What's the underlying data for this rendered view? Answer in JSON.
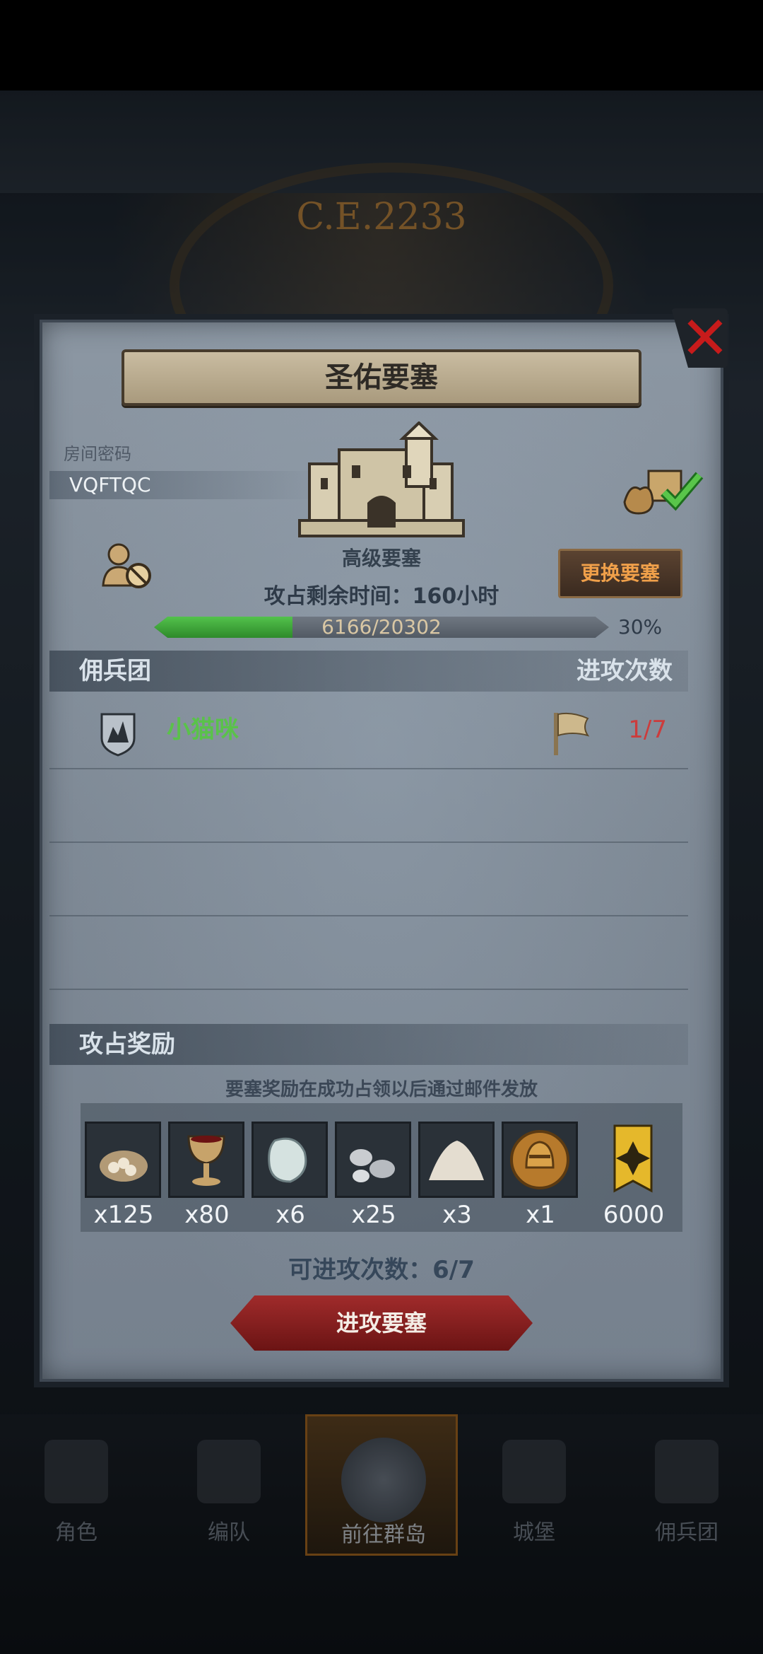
{
  "background": {
    "era_label": "C.E.2233"
  },
  "modal": {
    "title": "圣佑要塞",
    "room_code_label": "房间密码",
    "room_code": "VQFTQC",
    "fortress_grade": "高级要塞",
    "change_fortress_button": "更换要塞",
    "time_remaining": "攻占剩余时间：160小时",
    "progress": {
      "text": "6166/20302",
      "current": 6166,
      "total": 20302,
      "percent_label": "30%"
    },
    "mercenary_section": {
      "left_header": "佣兵团",
      "right_header": "进攻次数"
    },
    "mercenary_rows": [
      {
        "name": "小猫咪",
        "attacks": "1/7"
      }
    ],
    "reward_section": {
      "header": "攻占奖励",
      "note": "要塞奖励在成功占领以后通过邮件发放"
    },
    "rewards": [
      {
        "icon": "supply-sack-icon",
        "qty": "x125"
      },
      {
        "icon": "goblet-icon",
        "qty": "x80"
      },
      {
        "icon": "moonstone-icon",
        "qty": "x6"
      },
      {
        "icon": "silver-ore-icon",
        "qty": "x25"
      },
      {
        "icon": "salt-pile-icon",
        "qty": "x3"
      },
      {
        "icon": "knight-helmet-medal-icon",
        "qty": "x1"
      },
      {
        "icon": "banner-emblem-icon",
        "qty": "6000"
      }
    ],
    "attacks_available": "可进攻次数：6/7",
    "attack_button": "进攻要塞"
  },
  "bottom_nav": [
    {
      "label": "角色"
    },
    {
      "label": "编队"
    },
    {
      "label": "前往群岛"
    },
    {
      "label": "城堡"
    },
    {
      "label": "佣兵团"
    }
  ],
  "colors": {
    "merc_name": "#5ac24a",
    "attack_count": "#cc3c3c",
    "change_button_text": "#f0a04a",
    "close_icon": "#c71b1b"
  }
}
